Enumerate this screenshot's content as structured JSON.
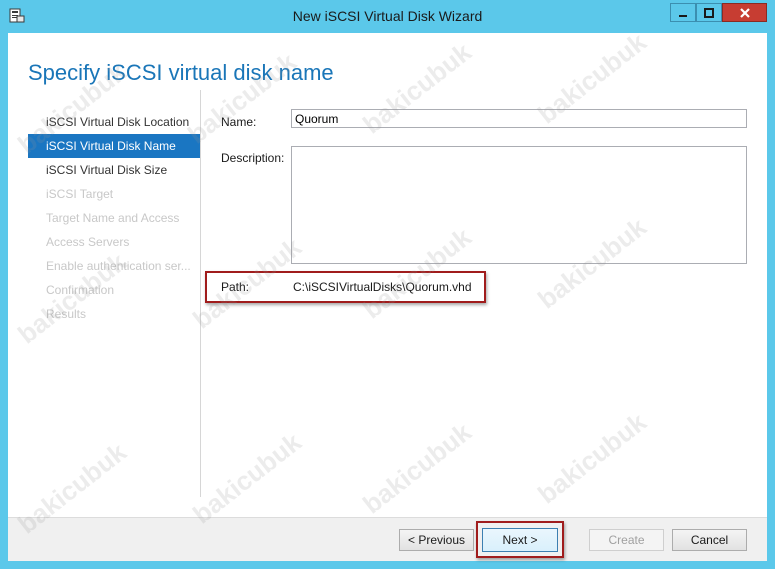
{
  "window": {
    "title": "New iSCSI Virtual Disk Wizard",
    "title_bg": "#5bc8ea",
    "close_bg": "#c73d32"
  },
  "page": {
    "heading": "Specify iSCSI virtual disk name"
  },
  "nav": {
    "items": [
      {
        "label": "iSCSI Virtual Disk Location",
        "state": "normal"
      },
      {
        "label": "iSCSI Virtual Disk Name",
        "state": "active"
      },
      {
        "label": "iSCSI Virtual Disk Size",
        "state": "normal"
      },
      {
        "label": "iSCSI Target",
        "state": "disabled"
      },
      {
        "label": "Target Name and Access",
        "state": "disabled"
      },
      {
        "label": "Access Servers",
        "state": "disabled"
      },
      {
        "label": "Enable authentication ser...",
        "state": "disabled"
      },
      {
        "label": "Confirmation",
        "state": "disabled"
      },
      {
        "label": "Results",
        "state": "disabled"
      }
    ],
    "active_bg": "#1a76c2"
  },
  "form": {
    "name_label": "Name:",
    "name_value": "Quorum",
    "description_label": "Description:",
    "description_value": "",
    "path_label": "Path:",
    "path_value": "C:\\iSCSIVirtualDisks\\Quorum.vhd"
  },
  "buttons": {
    "previous": "< Previous",
    "next": "Next >",
    "create": "Create",
    "cancel": "Cancel"
  },
  "watermark": "bakicubuk",
  "highlight_color": "#a01c1c"
}
